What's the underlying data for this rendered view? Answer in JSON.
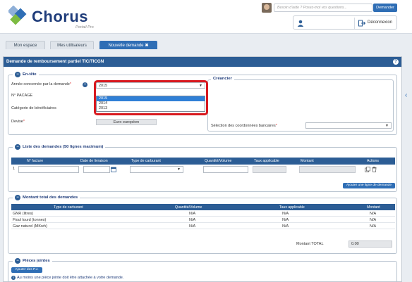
{
  "header": {
    "logo_text": "Chorus",
    "logo_sub": "Portail Pro",
    "help_placeholder": "Besoin d'aide ? Posez-moi vos questions...",
    "help_button": "Demander",
    "logout_label": "Déconnexion"
  },
  "tabs": [
    {
      "label": "Mon espace"
    },
    {
      "label": "Mes utilisateurs"
    },
    {
      "label": "Nouvelle demande",
      "close": "✖"
    }
  ],
  "panel": {
    "title": "Demande de remboursement partiel TIC/TICGN",
    "help": "?"
  },
  "entete": {
    "legend": "En-tête",
    "year_label": "Année concernée par la demande",
    "year_value": "2015",
    "year_options": [
      "2015",
      "2014",
      "2013"
    ],
    "pacage_label": "N° PACAGE",
    "beneficiary_label": "Catégorie de bénéficiaires",
    "currency_label": "Devise",
    "currency_value": "Euro européen",
    "creancier_legend": "Créancier",
    "bank_label": "Sélection des coordonnées bancaires"
  },
  "list": {
    "legend": "Liste des demandes (50 lignes maximum)",
    "columns": [
      "N° facture",
      "Date de livraison",
      "Type de carburant",
      "Quantité/Volume",
      "Taux applicable",
      "Montant",
      "Actions"
    ],
    "row_index": "1",
    "add_button": "Ajouter une ligne de demande"
  },
  "totals": {
    "legend": "Montant total des demandes",
    "columns": [
      "Type de carburant",
      "Quantité/Volume",
      "Taux applicable",
      "Montant"
    ],
    "rows": [
      {
        "type": "GNR (litres)",
        "qty": "N/A",
        "rate": "N/A",
        "amount": "N/A"
      },
      {
        "type": "Fioul lourd (tonnes)",
        "qty": "N/A",
        "rate": "N/A",
        "amount": "N/A"
      },
      {
        "type": "Gaz naturel (MKwh)",
        "qty": "N/A",
        "rate": "N/A",
        "amount": "N/A"
      }
    ],
    "total_label": "Montant TOTAL",
    "total_value": "0.00"
  },
  "attachments": {
    "legend": "Pièces jointes",
    "add_button": "Ajouter des P.J.",
    "info": "Au moins une pièce jointe doit être attachée à votre demande."
  }
}
